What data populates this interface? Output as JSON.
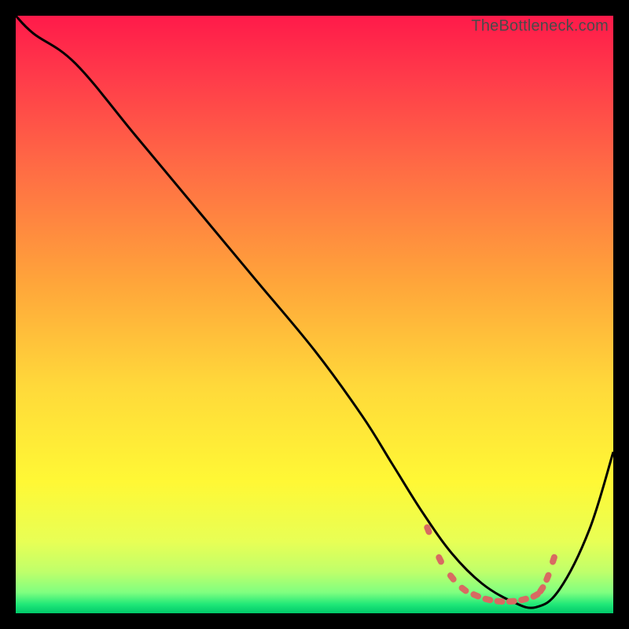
{
  "watermark": "TheBottleneck.com",
  "chart_data": {
    "type": "line",
    "title": "",
    "xlabel": "",
    "ylabel": "",
    "xlim": [
      0,
      100
    ],
    "ylim": [
      0,
      100
    ],
    "series": [
      {
        "name": "bottleneck-curve",
        "x": [
          0,
          3,
          10,
          20,
          30,
          40,
          50,
          58,
          63,
          68,
          73,
          78,
          83,
          87,
          91,
          96,
          100
        ],
        "y": [
          100,
          97,
          92,
          80,
          68,
          56,
          44,
          33,
          25,
          17,
          10,
          5,
          2,
          1,
          4,
          14,
          27
        ]
      }
    ],
    "optimal_region": {
      "name": "optimal-dots",
      "x": [
        69,
        71,
        73,
        75,
        77,
        79,
        81,
        83,
        85,
        87,
        88,
        89,
        90
      ],
      "y": [
        14,
        9,
        6,
        4,
        3,
        2.3,
        2,
        2,
        2.3,
        3,
        4,
        6,
        9
      ]
    },
    "gradient_stops": [
      {
        "offset": 0.0,
        "color": "#ff1a4a"
      },
      {
        "offset": 0.1,
        "color": "#ff3a4a"
      },
      {
        "offset": 0.25,
        "color": "#ff6a45"
      },
      {
        "offset": 0.45,
        "color": "#ffa63a"
      },
      {
        "offset": 0.62,
        "color": "#ffd93a"
      },
      {
        "offset": 0.78,
        "color": "#fff835"
      },
      {
        "offset": 0.88,
        "color": "#e8ff55"
      },
      {
        "offset": 0.93,
        "color": "#c0ff6a"
      },
      {
        "offset": 0.965,
        "color": "#80ff80"
      },
      {
        "offset": 0.985,
        "color": "#20e878"
      },
      {
        "offset": 1.0,
        "color": "#00c86a"
      }
    ],
    "dot_color": "#d86a62",
    "curve_color": "#000000"
  }
}
